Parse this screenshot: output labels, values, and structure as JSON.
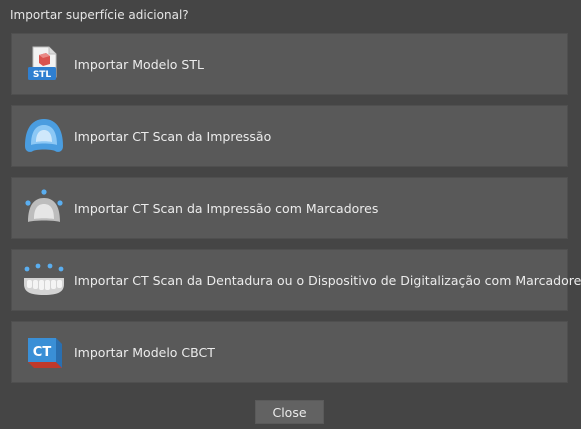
{
  "dialog": {
    "title": "Importar superfície adicional?",
    "close_label": "Close"
  },
  "options": [
    {
      "label": "Importar Modelo STL",
      "icon": "stl-file-icon",
      "icon_text": "STL"
    },
    {
      "label": "Importar CT Scan da Impressão",
      "icon": "impression-scan-icon"
    },
    {
      "label": "Importar CT Scan da Impressão com Marcadores",
      "icon": "impression-markers-icon"
    },
    {
      "label": "Importar CT Scan da Dentadura ou o Dispositivo de Digitalização com Marcadores",
      "icon": "denture-markers-icon"
    },
    {
      "label": "Importar Modelo CBCT",
      "icon": "cbct-model-icon",
      "icon_text": "CT"
    }
  ],
  "colors": {
    "background": "#454545",
    "option_bg": "#595959",
    "accent_blue": "#3a8fd6",
    "accent_red": "#c0392b"
  }
}
